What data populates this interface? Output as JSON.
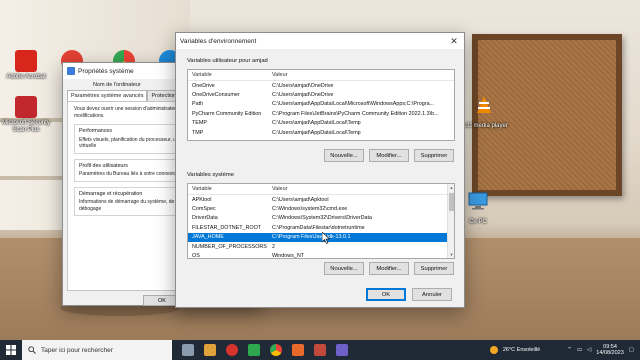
{
  "desktop": {
    "icons": [
      {
        "label": "Adobe Acrobat",
        "icon": "adobe-acrobat-icon"
      },
      {
        "label": "Microsoft Security Scan Plus",
        "icon": "ms-security-icon"
      },
      {
        "label": "VLC media player",
        "icon": "vlc-icon"
      },
      {
        "label": "Ce PC",
        "icon": "computer-icon"
      }
    ]
  },
  "system_properties": {
    "title": "Propriétés système",
    "tabs_row1": [
      "Nom de l'ordinateur"
    ],
    "tabs_row2": [
      "Paramètres système avancés",
      "Protection du"
    ],
    "intro": "Vous devez ouvrir une session d'administrateur pour effectuer la plupart de ces modifications.",
    "groups": [
      {
        "title": "Performances",
        "text": "Effets visuels, planification du processeur, utilisation de la mémoire virtuelle"
      },
      {
        "title": "Profil des utilisateurs",
        "text": "Paramètres du Bureau liés à votre connexion"
      },
      {
        "title": "Démarrage et récupération",
        "text": "Informations de démarrage du système, de défaillance du système et de débogage"
      }
    ],
    "side_button": "V",
    "ok_label": "OK"
  },
  "env_dialog": {
    "title": "Variables d'environnement",
    "user_section": "Variables utilisateur pour amjad",
    "system_section": "Variables système",
    "col_variable": "Variable",
    "col_value": "Valeur",
    "user_vars": [
      {
        "name": "OneDrive",
        "value": "C:\\Users\\amjad\\OneDrive"
      },
      {
        "name": "OneDriveConsumer",
        "value": "C:\\Users\\amjad\\OneDrive"
      },
      {
        "name": "Path",
        "value": "C:\\Users\\amjad\\AppData\\Local\\Microsoft\\WindowsApps;C:\\Progra..."
      },
      {
        "name": "PyCharm Community Edition",
        "value": "C:\\Program Files\\JetBrains\\PyCharm Community Edition 2022.1.3\\b..."
      },
      {
        "name": "TEMP",
        "value": "C:\\Users\\amjad\\AppData\\Local\\Temp"
      },
      {
        "name": "TMP",
        "value": "C:\\Users\\amjad\\AppData\\Local\\Temp"
      }
    ],
    "system_vars": [
      {
        "name": "APKtool",
        "value": "C:\\Users\\amjad\\Apktool"
      },
      {
        "name": "ComSpec",
        "value": "C:\\Windows\\system32\\cmd.exe"
      },
      {
        "name": "DriverData",
        "value": "C:\\Windows\\System32\\Drivers\\DriverData"
      },
      {
        "name": "FILESTAR_DOTNET_ROOT",
        "value": "C:\\ProgramData\\Filestar\\dotnetruntime"
      },
      {
        "name": "JAVA_HOME",
        "value": "C:\\Program Files\\Java\\jdk-13.0.1",
        "selected": true
      },
      {
        "name": "NUMBER_OF_PROCESSORS",
        "value": "2"
      },
      {
        "name": "OS",
        "value": "Windows_NT"
      }
    ],
    "buttons": {
      "new": "Nouvelle...",
      "edit": "Modifier...",
      "delete": "Supprimer",
      "ok": "OK",
      "cancel": "Annuler"
    }
  },
  "taskbar": {
    "search_placeholder": "Taper ici pour rechercher",
    "weather": "26°C  Ensoleillé",
    "time": "09:54",
    "date": "14/08/2023"
  },
  "colors": {
    "accent": "#0078d7",
    "taskbar": "#1f2a36",
    "selection": "#0078d7"
  }
}
